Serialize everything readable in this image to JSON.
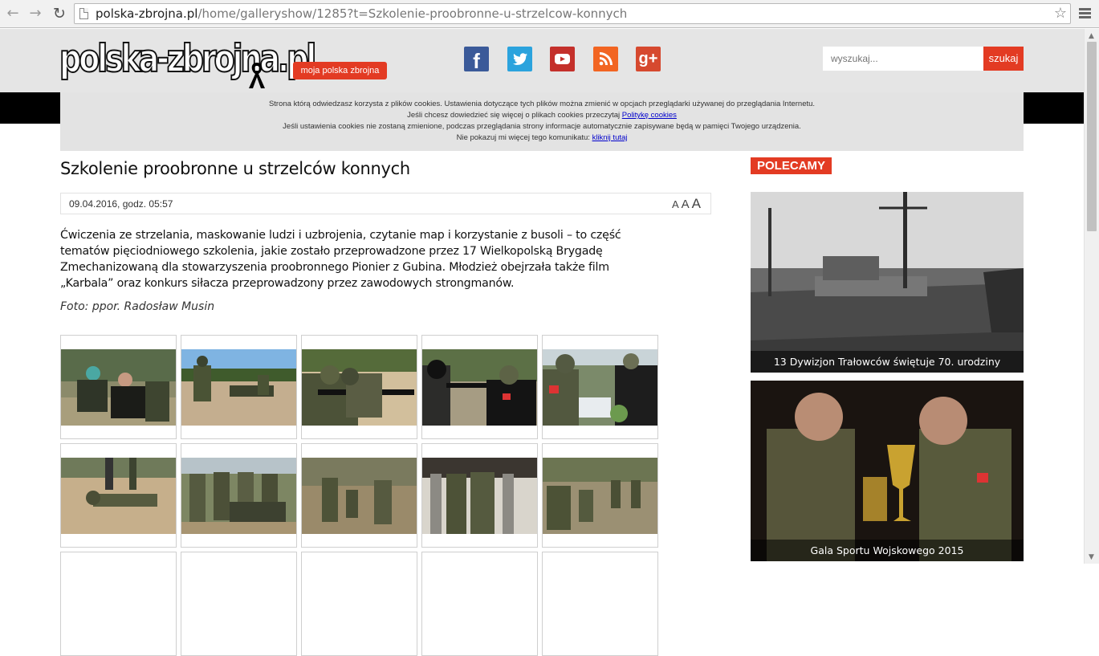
{
  "browser": {
    "url_host": "polska-zbrojna.pl",
    "url_path": "/home/galleryshow/1285?t=Szkolenie-proobronne-u-strzelcow-konnych"
  },
  "header": {
    "logo_text": "polska-zbrojna.pl",
    "moja_label": "moja polska zbrojna",
    "social_icons": [
      "facebook-icon",
      "twitter-icon",
      "youtube-icon",
      "rss-icon",
      "google-plus-icon"
    ],
    "search_placeholder": "wyszukaj...",
    "search_button": "szukaj",
    "accent_color": "#e33b23"
  },
  "cookie": {
    "line1": "Strona którą odwiedzasz korzysta z plików cookies. Ustawienia dotyczące tych plików można zmienić w opcjach przeglądarki używanej do przeglądania Internetu.",
    "line2_pre": "Jeśli chcesz dowiedzieć się więcej o plikach cookies przeczytaj ",
    "line2_link": "Politykę cookies",
    "line3": "Jeśli ustawienia cookies nie zostaną zmienione, podczas przeglądania strony informacje automatycznie zapisywane będą w pamięci Twojego urządzenia.",
    "line4_pre": "Nie pokazuj mi więcej tego komunikatu: ",
    "line4_link": "kliknij tutaj"
  },
  "article": {
    "title": "Szkolenie proobronne u strzelców konnych",
    "date": "09.04.2016, godz. 05:57",
    "font_sizes": [
      "A",
      "A",
      "A"
    ],
    "lead": "Ćwiczenia ze strzelania, maskowanie ludzi i uzbrojenia, czytanie map i korzystanie z busoli – to część tematów pięciodniowego szkolenia, jakie zostało przeprowadzone przez 17 Wielkopolską Brygadę Zmechanizowaną dla stowarzyszenia proobronnego Pionier z Gubina. Młodzież obejrzała także film „Karbala” oraz konkurs siłacza przeprowadzony przez zawodowych strongmanów.",
    "credit": "Foto: ppor. Radosław Musin"
  },
  "sidebar": {
    "heading": "POLECAMY",
    "items": [
      {
        "caption": "13 Dywizjon Trałowców świętuje 70. urodziny"
      },
      {
        "caption": "Gala Sportu Wojskowego 2015"
      }
    ]
  }
}
